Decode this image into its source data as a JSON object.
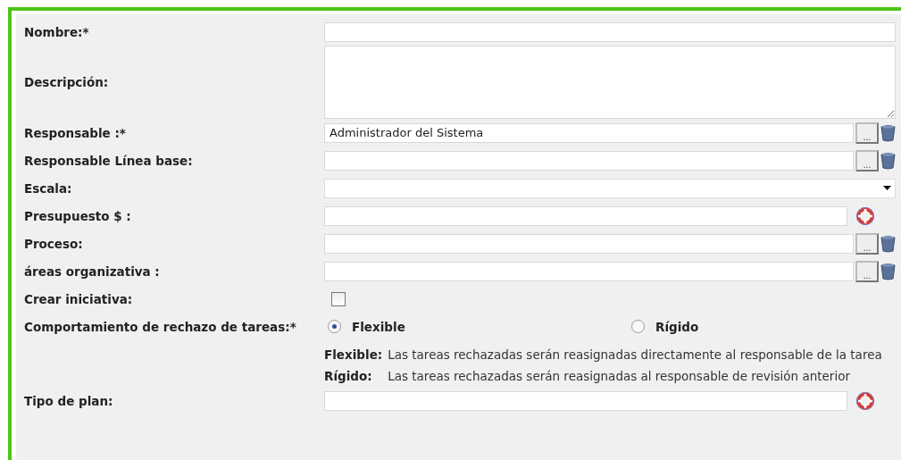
{
  "form": {
    "fields": [
      {
        "kind": "text",
        "label": "Nombre:*"
      },
      {
        "kind": "textarea",
        "label": "Descripción:"
      },
      {
        "kind": "picker",
        "label": "Responsable :*",
        "value": "Administrador del Sistema",
        "button": "..."
      },
      {
        "kind": "picker",
        "label": "Responsable Línea base:",
        "button": "..."
      },
      {
        "kind": "select",
        "label": "Escala:"
      },
      {
        "kind": "help",
        "label": "Presupuesto $ :"
      },
      {
        "kind": "picker",
        "label": "Proceso:",
        "button": "..."
      },
      {
        "kind": "picker",
        "label": "áreas organizativa :",
        "button": "..."
      },
      {
        "kind": "checkbox",
        "label": "Crear iniciativa:",
        "checked": false
      },
      {
        "kind": "radio",
        "label": "Comportamiento de rechazo de tareas:*",
        "options": [
          {
            "label": "Flexible",
            "selected": true
          },
          {
            "label": "Rígido",
            "selected": false
          }
        ],
        "notes": [
          {
            "term": "Flexible:",
            "text": "Las tareas rechazadas serán reasignadas directamente al responsable de la tarea"
          },
          {
            "term": "Rígido:",
            "text": "Las tareas rechazadas serán reasignadas al responsable de revisión anterior"
          }
        ]
      },
      {
        "kind": "help",
        "label": "Tipo de plan:"
      }
    ]
  }
}
